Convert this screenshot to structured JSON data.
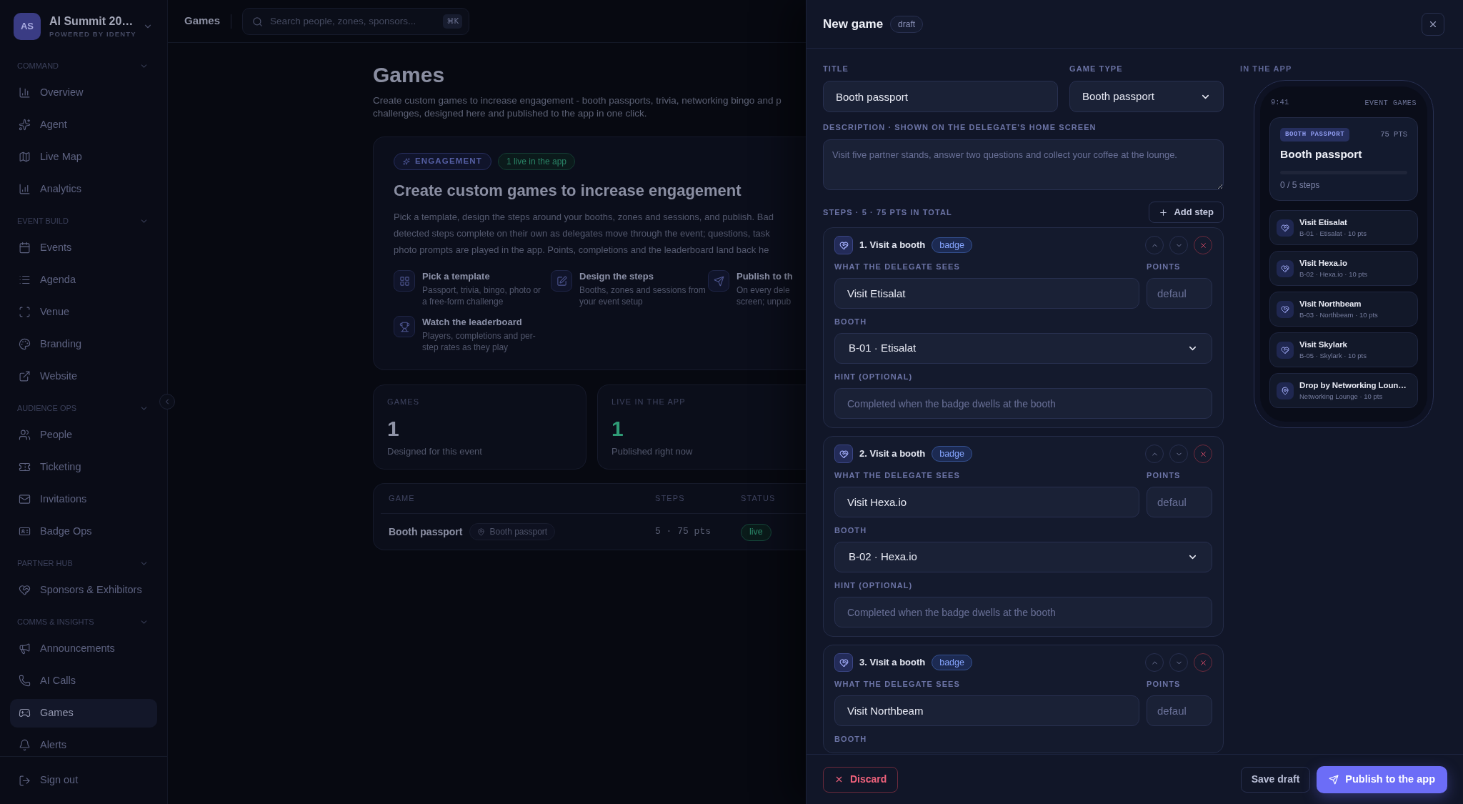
{
  "sidebar": {
    "workspace": {
      "initials": "AS",
      "name": "AI Summit 20…",
      "subtitle": "POWERED BY IDENTY"
    },
    "sections": [
      {
        "title": "COMMAND",
        "expanded": true,
        "items": [
          {
            "label": "Overview",
            "selected": false
          },
          {
            "label": "Agent",
            "selected": false
          },
          {
            "label": "Live Map",
            "selected": false
          },
          {
            "label": "Analytics",
            "selected": false
          }
        ]
      },
      {
        "title": "EVENT BUILD",
        "expanded": true,
        "items": [
          {
            "label": "Events",
            "selected": false
          },
          {
            "label": "Agenda",
            "selected": false
          },
          {
            "label": "Venue",
            "selected": false
          },
          {
            "label": "Branding",
            "selected": false
          },
          {
            "label": "Website",
            "selected": false
          }
        ]
      },
      {
        "title": "AUDIENCE OPS",
        "expanded": true,
        "items": [
          {
            "label": "People",
            "selected": false
          },
          {
            "label": "Ticketing",
            "selected": false
          },
          {
            "label": "Invitations",
            "selected": false
          },
          {
            "label": "Badge Ops",
            "selected": false
          }
        ]
      },
      {
        "title": "PARTNER HUB",
        "expanded": true,
        "items": [
          {
            "label": "Sponsors & Exhibitors",
            "selected": false
          }
        ]
      },
      {
        "title": "COMMS & INSIGHTS",
        "expanded": true,
        "items": [
          {
            "label": "Announcements",
            "selected": false
          },
          {
            "label": "AI Calls",
            "selected": false
          },
          {
            "label": "Games",
            "selected": true
          },
          {
            "label": "Alerts",
            "selected": false
          }
        ]
      }
    ],
    "footer": {
      "label": "Sign out"
    }
  },
  "topbar": {
    "title": "Games",
    "search": {
      "placeholder": "Search people, zones, sponsors...",
      "shortcut": "⌘K"
    }
  },
  "page": {
    "title": "Games",
    "description_lines": [
      "Create custom games to increase engagement - booth passports, trivia, networking bingo and p",
      "challenges, designed here and published to the app in one click."
    ],
    "hero": {
      "badges": [
        {
          "kind": "category",
          "label": "ENGAGEMENT"
        },
        {
          "kind": "status",
          "label": "1 live in the app"
        }
      ],
      "title": "Create custom games to increase engagement",
      "lines": [
        "Pick a template, design the steps around your booths, zones and sessions, and publish. Bad",
        "detected steps complete on their own as delegates move through the event; questions, task",
        "photo prompts are played in the app. Points, completions and the leaderboard land back he"
      ],
      "features": [
        {
          "title": "Pick a template",
          "lines": [
            "Passport, trivia, bingo, photo or",
            "a free-form challenge"
          ]
        },
        {
          "title": "Design the steps",
          "lines": [
            "Booths, zones and sessions from",
            "your event setup"
          ]
        },
        {
          "title": "Publish to th",
          "lines": [
            "On every dele",
            "screen; unpub"
          ]
        },
        {
          "title": "Watch the leaderboard",
          "lines": [
            "Players, completions and per-",
            "step rates as they play"
          ]
        }
      ]
    },
    "stats": [
      {
        "label": "GAMES",
        "value": "1",
        "caption": "Designed for this event",
        "color": "#8f93a6"
      },
      {
        "label": "LIVE IN THE APP",
        "value": "1",
        "caption": "Published right now",
        "color": "#2f9b76"
      }
    ],
    "table": {
      "columns": [
        "GAME",
        "STEPS",
        "STATUS"
      ],
      "rows": [
        {
          "game": "Booth passport",
          "type": "Booth passport",
          "steps": "5 · 75 pts",
          "status": "live"
        }
      ]
    }
  },
  "drawer": {
    "title": "New game",
    "status": "draft",
    "fields": {
      "title": {
        "label": "TITLE",
        "value": "Booth passport"
      },
      "game_type": {
        "label": "GAME TYPE",
        "value": "Booth passport"
      },
      "description": {
        "label": "DESCRIPTION · SHOWN ON THE DELEGATE'S HOME SCREEN",
        "placeholder": "Visit five partner stands, answer two questions and collect your coffee at the lounge."
      }
    },
    "steps_heading": "STEPS · 5 · 75 PTS IN TOTAL",
    "add_step": "Add step",
    "steps": [
      {
        "title": "1. Visit a booth",
        "trigger": "badge",
        "text_label": "WHAT THE DELEGATE SEES",
        "text": "Visit Etisalat",
        "points_label": "POINTS",
        "points_placeholder": "defaul",
        "booth_label": "BOOTH",
        "booth": "B-01 · Etisalat",
        "hint_label": "HINT (OPTIONAL)",
        "hint_placeholder": "Completed when the badge dwells at the booth"
      },
      {
        "title": "2. Visit a booth",
        "trigger": "badge",
        "text_label": "WHAT THE DELEGATE SEES",
        "text": "Visit Hexa.io",
        "points_label": "POINTS",
        "points_placeholder": "defaul",
        "booth_label": "BOOTH",
        "booth": "B-02 · Hexa.io",
        "hint_label": "HINT (OPTIONAL)",
        "hint_placeholder": "Completed when the badge dwells at the booth"
      },
      {
        "title": "3. Visit a booth",
        "trigger": "badge",
        "text_label": "WHAT THE DELEGATE SEES",
        "text": "Visit Northbeam",
        "points_label": "POINTS",
        "points_placeholder": "defaul",
        "booth_label": "BOOTH"
      }
    ],
    "preview": {
      "label": "IN THE APP",
      "time": "9:41",
      "screen_title": "EVENT GAMES",
      "game": {
        "type": "BOOTH PASSPORT",
        "points": "75 PTS",
        "title": "Booth passport",
        "level": 0,
        "progress": "0 / 5 steps"
      },
      "steps": [
        {
          "kind": "booth",
          "title": "Visit Etisalat",
          "detail": "B-01 · Etisalat · 10 pts"
        },
        {
          "kind": "booth",
          "title": "Visit Hexa.io",
          "detail": "B-02 · Hexa.io · 10 pts"
        },
        {
          "kind": "booth",
          "title": "Visit Northbeam",
          "detail": "B-03 · Northbeam · 10 pts"
        },
        {
          "kind": "booth",
          "title": "Visit Skylark",
          "detail": "B-05 · Skylark · 10 pts"
        },
        {
          "kind": "zone",
          "title": "Drop by Networking Loun…",
          "detail": "Networking Lounge · 10 pts"
        }
      ]
    },
    "footer": {
      "discard": "Discard",
      "save": "Save draft",
      "publish": "Publish to the app"
    }
  }
}
